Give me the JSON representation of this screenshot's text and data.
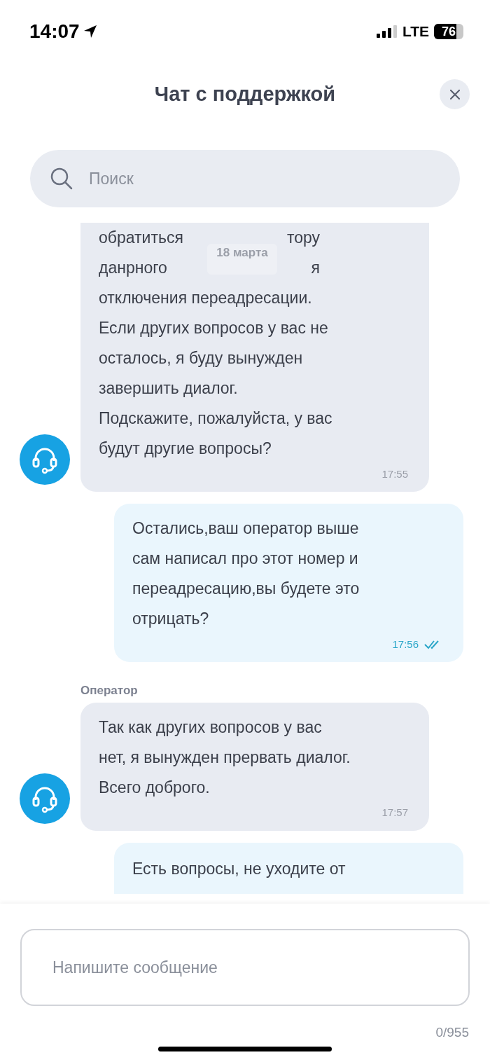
{
  "status_bar": {
    "time": "14:07",
    "network": "LTE",
    "battery": "76"
  },
  "header": {
    "title": "Чат с поддержкой"
  },
  "search": {
    "placeholder": "Поиск"
  },
  "date_label": "18 марта",
  "messages": [
    {
      "kind": "incoming",
      "lines": [
        [
          "обратиться",
          "тору"
        ],
        [
          "данрного",
          "я"
        ],
        "отключения переадресации.",
        "Если других вопросов у вас не",
        "осталось, я буду вынужден",
        "завершить диалог.",
        "Подскажите, пожалуйста, у вас",
        "будут другие вопросы?"
      ],
      "time": "17:55"
    },
    {
      "kind": "outgoing",
      "lines": [
        "Остались,ваш оператор выше",
        "сам написал про этот номер и",
        "переадресацию,вы будете это",
        "отрицать?"
      ],
      "time": "17:56",
      "read": true
    },
    {
      "kind": "incoming",
      "sender": "Оператор",
      "lines": [
        "Так как других вопросов у вас",
        "нет, я вынужден прервать диалог.",
        "Всего доброго."
      ],
      "time": "17:57"
    },
    {
      "kind": "outgoing",
      "lines": [
        "Есть вопросы, не уходите от"
      ]
    }
  ],
  "composer": {
    "placeholder": "Напишите сообщение",
    "counter": "0/955"
  }
}
